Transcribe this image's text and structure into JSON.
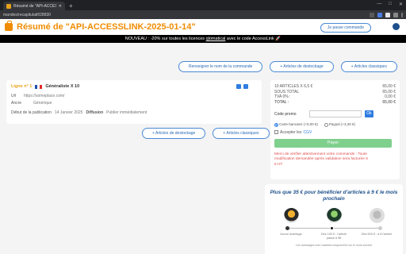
{
  "browser": {
    "tab_title": "Résumé de \"API-ACCESSLINK-2…",
    "new_tab_symbol": "+",
    "window_controls": [
      "—",
      "□",
      "✕"
    ],
    "address": "mandes/recapitulatif/28830"
  },
  "header": {
    "title": "Résumé de \"API-ACCESSLINK-2025-01-14\"",
    "my_orders_button": "Je passe commande"
  },
  "banner": {
    "text_before": "NOUVEAU : -20% sur toutes les licences ",
    "link_text": "qlomatical",
    "text_after": " avec le code AccessLink 🚀"
  },
  "top_actions": {
    "rename_button": "Renseigner le nom de la commande",
    "add_stock_button": "+ Articles de destockage",
    "add_classic_button": "+ Articles classiques"
  },
  "line_item": {
    "line_label": "Ligne n° 1",
    "product": "Généraliste X 10",
    "url_label": "Url",
    "url_value": "https://someplace.com/",
    "anchor_label": "Ancre",
    "anchor_value": "Générique",
    "pub_label": "Début de la publication",
    "pub_value": "14 Janvier 2025",
    "diffusion_label": "Diffusion",
    "diffusion_value": "Publier immédiatement"
  },
  "mid_actions": {
    "add_stock_button": "+ Articles de destockage",
    "add_classic_button": "+ Articles classiques"
  },
  "summary": {
    "lines": [
      {
        "label": "10 ARTICLES X 6,5 €",
        "value": "65,00 €"
      },
      {
        "label": "SOUS TOTAL",
        "value": "65,00 €"
      },
      {
        "label": "TVA 0% :",
        "value": "0,00 €"
      },
      {
        "label": "TOTAL :",
        "value": "65,00 €"
      }
    ],
    "promo_label": "Code promo",
    "promo_placeholder": "",
    "ok_label": "Ok",
    "card_option": "Carte bancaire (+0,00 €)",
    "paypal_option": "Paypal (+3,25 €)",
    "accept_text": "Accepter les ",
    "cgv_link": "CGV",
    "pay_button": "Payer",
    "warning": "Merci de vérifier attentivement votre commande : Toute modification demandée après validation sera facturée 5 € HT"
  },
  "rewards_promo": {
    "title": "Plus que 35 € pour bénéficier d'articles à 9 € le mois prochain",
    "labels": [
      "Aucun avantage",
      "Dès 100 € : l'article passe à 9€",
      "Dès 500 € : à 8 l'article"
    ],
    "footnote": "Les avantages sont valables uniquement sur le mois suivant",
    "progress_fraction": 0.48
  },
  "colors": {
    "brand_orange": "#f08c00",
    "primary_blue": "#2f7de1",
    "pay_green": "#7fcf8d",
    "warning_red": "#e04c4c"
  }
}
